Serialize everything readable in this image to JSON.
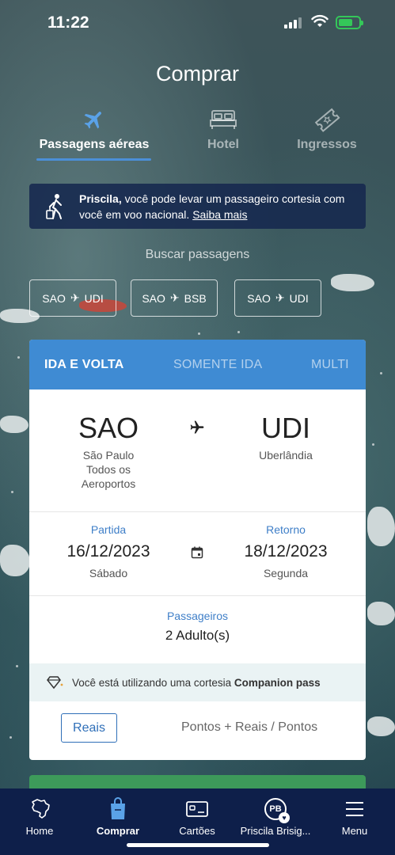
{
  "status": {
    "time": "11:22"
  },
  "page": {
    "title": "Comprar"
  },
  "tabs": [
    {
      "label": "Passagens aéreas",
      "icon": "airplane-icon",
      "active": true
    },
    {
      "label": "Hotel",
      "icon": "bed-icon",
      "active": false
    },
    {
      "label": "Ingressos",
      "icon": "ticket-icon",
      "active": false
    }
  ],
  "promo": {
    "name": "Priscila,",
    "text": " você pode levar um passageiro cortesia com você em voo nacional. ",
    "link": "Saiba mais"
  },
  "search": {
    "label": "Buscar passagens",
    "recent": [
      {
        "from": "SAO",
        "to": "UDI"
      },
      {
        "from": "SAO",
        "to": "BSB"
      },
      {
        "from": "SAO",
        "to": "UDI"
      }
    ]
  },
  "trip_types": [
    "IDA E VOLTA",
    "SOMENTE IDA",
    "MULTI"
  ],
  "route": {
    "origin_code": "SAO",
    "origin_city_line1": "São Paulo",
    "origin_city_line2": "Todos os",
    "origin_city_line3": "Aeroportos",
    "dest_code": "UDI",
    "dest_city": "Uberlândia"
  },
  "dates": {
    "departure_label": "Partida",
    "departure_date": "16/12/2023",
    "departure_weekday": "Sábado",
    "return_label": "Retorno",
    "return_date": "18/12/2023",
    "return_weekday": "Segunda"
  },
  "passengers": {
    "label": "Passageiros",
    "value": "2 Adulto(s)"
  },
  "companion": {
    "text": "Você está utilizando uma cortesia ",
    "bold": "Companion pass"
  },
  "currency": {
    "selected": "Reais",
    "alternative": "Pontos + Reais / Pontos"
  },
  "nav": [
    {
      "label": "Home",
      "icon": "brazil-map-icon"
    },
    {
      "label": "Comprar",
      "icon": "shopping-bag-icon",
      "active": true
    },
    {
      "label": "Cartões",
      "icon": "card-icon"
    },
    {
      "label": "Priscila Brisig...",
      "icon": "avatar",
      "initials": "PB"
    },
    {
      "label": "Menu",
      "icon": "hamburger-icon"
    }
  ],
  "colors": {
    "accent": "#3f8bd3",
    "nav_bg": "#0e1f4a",
    "promo_bg": "#16284e",
    "cta_green": "#3d9a5a"
  }
}
